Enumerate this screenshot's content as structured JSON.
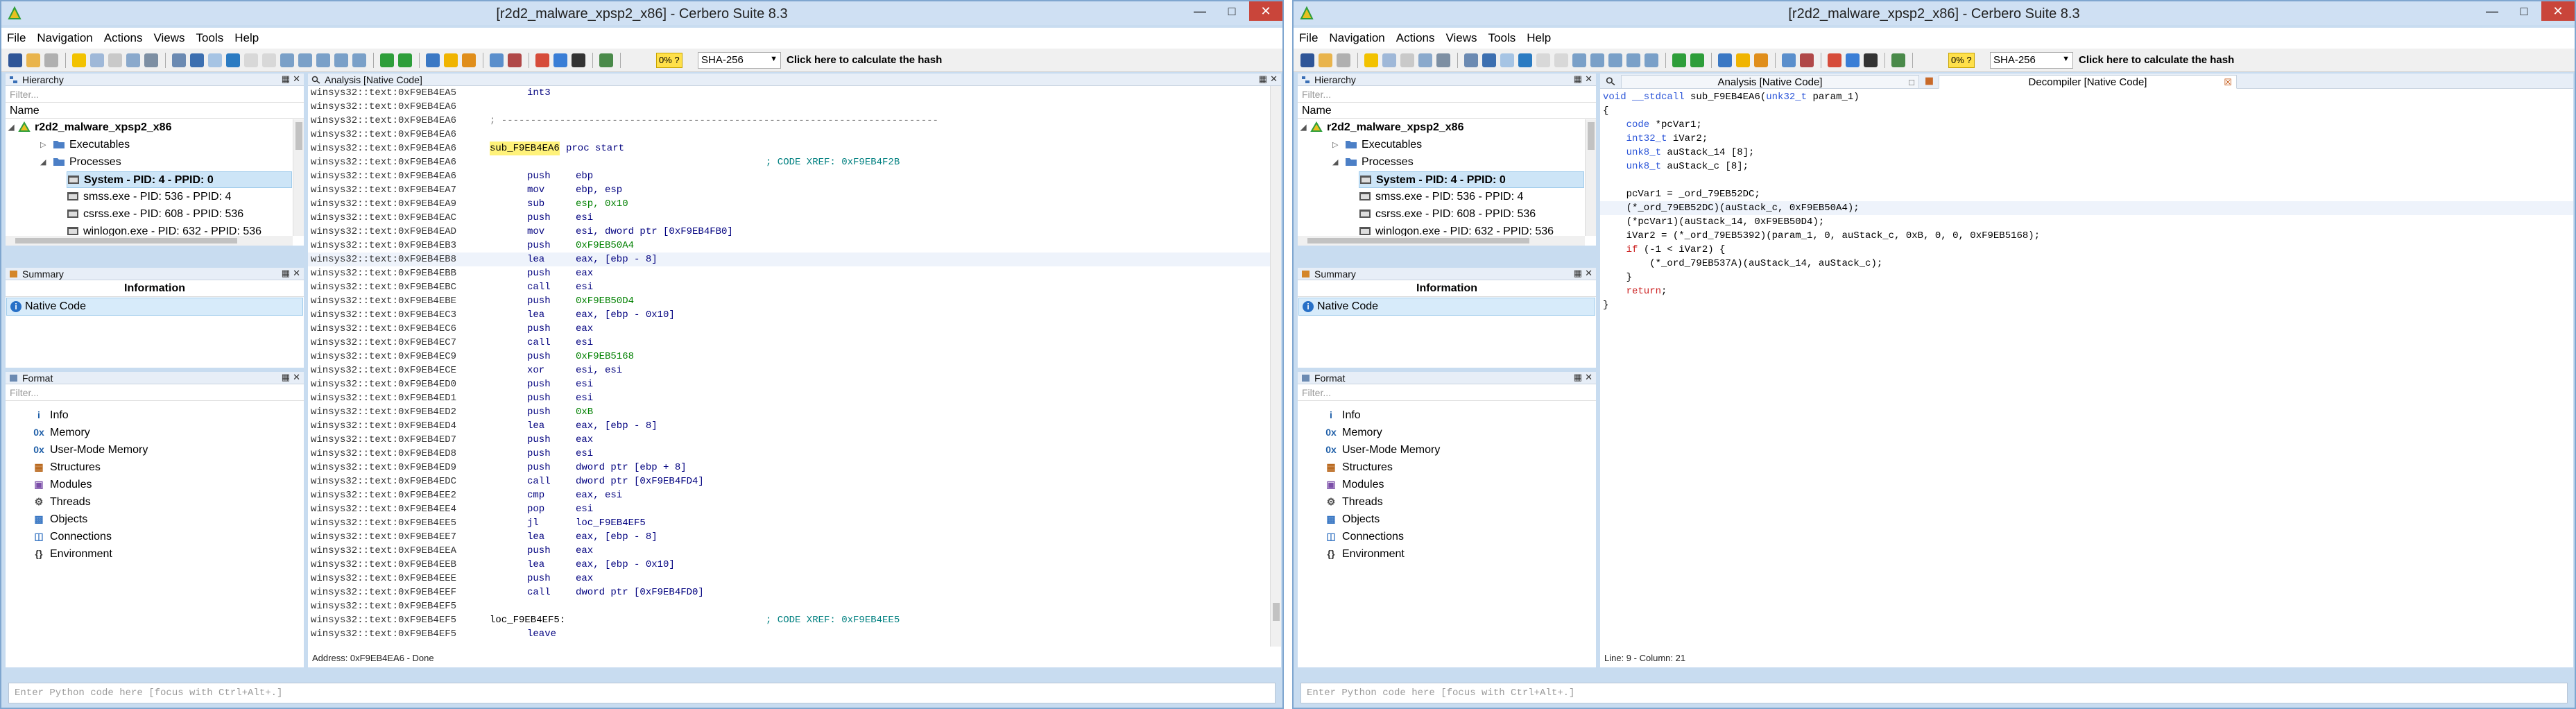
{
  "left": {
    "title": "[r2d2_malware_xpsp2_x86] - Cerbero Suite 8.3",
    "menu": [
      "File",
      "Navigation",
      "Actions",
      "Views",
      "Tools",
      "Help"
    ],
    "toolbar": {
      "badge": "0% ?",
      "hash_algo": "SHA-256",
      "calc_hash": "Click here to calculate the hash"
    },
    "hierarchy": {
      "header": "Hierarchy",
      "filter_placeholder": "Filter...",
      "column": "Name",
      "items": [
        "r2d2_malware_xpsp2_x86",
        "Executables",
        "Processes",
        "System - PID: 4 - PPID: 0",
        "smss.exe - PID: 536 - PPID: 4",
        "csrss.exe - PID: 608 - PPID: 536",
        "winlogon.exe - PID: 632 - PPID: 536"
      ]
    },
    "summary": {
      "header": "Summary",
      "title": "Information",
      "row": "Native Code"
    },
    "format": {
      "header": "Format",
      "filter_placeholder": "Filter...",
      "items": [
        "Info",
        "Memory",
        "User-Mode Memory",
        "Structures",
        "Modules",
        "Threads",
        "Objects",
        "Connections",
        "Environment"
      ],
      "icons": [
        "info-icon",
        "memory-icon",
        "memory-icon",
        "structures-icon",
        "modules-icon",
        "threads-icon",
        "objects-icon",
        "connections-icon",
        "environment-icon"
      ]
    },
    "analysis": {
      "header": "Analysis [Native Code]",
      "status": "Address: 0xF9EB4EA6 - Done",
      "lines": [
        {
          "a": "winsys32::text:0xF9EB4EA5",
          "m": "int3",
          "o": "",
          "c": ""
        },
        {
          "a": "winsys32::text:0xF9EB4EA6",
          "m": "",
          "o": "",
          "c": ""
        },
        {
          "a": "winsys32::text:0xF9EB4EA6",
          "m": "; ---------------------------------------------------------------------------",
          "o": "",
          "c": ""
        },
        {
          "a": "winsys32::text:0xF9EB4EA6",
          "m": "",
          "o": "",
          "c": ""
        },
        {
          "a": "winsys32::text:0xF9EB4EA6",
          "m": "sub_F9EB4EA6",
          "o": "proc start",
          "c": ""
        },
        {
          "a": "winsys32::text:0xF9EB4EA6",
          "m": "",
          "o": "",
          "c": "; CODE XREF: 0xF9EB4F2B"
        },
        {
          "a": "winsys32::text:0xF9EB4EA6",
          "m": "push",
          "o": "ebp",
          "c": ""
        },
        {
          "a": "winsys32::text:0xF9EB4EA7",
          "m": "mov",
          "o": "ebp, esp",
          "c": ""
        },
        {
          "a": "winsys32::text:0xF9EB4EA9",
          "m": "sub",
          "o": "esp, 0x10",
          "c": ""
        },
        {
          "a": "winsys32::text:0xF9EB4EAC",
          "m": "push",
          "o": "esi",
          "c": ""
        },
        {
          "a": "winsys32::text:0xF9EB4EAD",
          "m": "mov",
          "o": "esi, dword ptr [0xF9EB4FB0]",
          "c": ""
        },
        {
          "a": "winsys32::text:0xF9EB4EB3",
          "m": "push",
          "o": "0xF9EB50A4",
          "c": ""
        },
        {
          "a": "winsys32::text:0xF9EB4EB8",
          "m": "lea",
          "o": "eax, [ebp - 8]",
          "c": ""
        },
        {
          "a": "winsys32::text:0xF9EB4EBB",
          "m": "push",
          "o": "eax",
          "c": ""
        },
        {
          "a": "winsys32::text:0xF9EB4EBC",
          "m": "call",
          "o": "esi",
          "c": ""
        },
        {
          "a": "winsys32::text:0xF9EB4EBE",
          "m": "push",
          "o": "0xF9EB50D4",
          "c": ""
        },
        {
          "a": "winsys32::text:0xF9EB4EC3",
          "m": "lea",
          "o": "eax, [ebp - 0x10]",
          "c": ""
        },
        {
          "a": "winsys32::text:0xF9EB4EC6",
          "m": "push",
          "o": "eax",
          "c": ""
        },
        {
          "a": "winsys32::text:0xF9EB4EC7",
          "m": "call",
          "o": "esi",
          "c": ""
        },
        {
          "a": "winsys32::text:0xF9EB4EC9",
          "m": "push",
          "o": "0xF9EB5168",
          "c": ""
        },
        {
          "a": "winsys32::text:0xF9EB4ECE",
          "m": "xor",
          "o": "esi, esi",
          "c": ""
        },
        {
          "a": "winsys32::text:0xF9EB4ED0",
          "m": "push",
          "o": "esi",
          "c": ""
        },
        {
          "a": "winsys32::text:0xF9EB4ED1",
          "m": "push",
          "o": "esi",
          "c": ""
        },
        {
          "a": "winsys32::text:0xF9EB4ED2",
          "m": "push",
          "o": "0xB",
          "c": ""
        },
        {
          "a": "winsys32::text:0xF9EB4ED4",
          "m": "lea",
          "o": "eax, [ebp - 8]",
          "c": ""
        },
        {
          "a": "winsys32::text:0xF9EB4ED7",
          "m": "push",
          "o": "eax",
          "c": ""
        },
        {
          "a": "winsys32::text:0xF9EB4ED8",
          "m": "push",
          "o": "esi",
          "c": ""
        },
        {
          "a": "winsys32::text:0xF9EB4ED9",
          "m": "push",
          "o": "dword ptr [ebp + 8]",
          "c": ""
        },
        {
          "a": "winsys32::text:0xF9EB4EDC",
          "m": "call",
          "o": "dword ptr [0xF9EB4FD4]",
          "c": ""
        },
        {
          "a": "winsys32::text:0xF9EB4EE2",
          "m": "cmp",
          "o": "eax, esi",
          "c": ""
        },
        {
          "a": "winsys32::text:0xF9EB4EE4",
          "m": "pop",
          "o": "esi",
          "c": ""
        },
        {
          "a": "winsys32::text:0xF9EB4EE5",
          "m": "jl",
          "o": "loc_F9EB4EF5",
          "c": ""
        },
        {
          "a": "winsys32::text:0xF9EB4EE7",
          "m": "lea",
          "o": "eax, [ebp - 8]",
          "c": ""
        },
        {
          "a": "winsys32::text:0xF9EB4EEA",
          "m": "push",
          "o": "eax",
          "c": ""
        },
        {
          "a": "winsys32::text:0xF9EB4EEB",
          "m": "lea",
          "o": "eax, [ebp - 0x10]",
          "c": ""
        },
        {
          "a": "winsys32::text:0xF9EB4EEE",
          "m": "push",
          "o": "eax",
          "c": ""
        },
        {
          "a": "winsys32::text:0xF9EB4EEF",
          "m": "call",
          "o": "dword ptr [0xF9EB4FD0]",
          "c": ""
        },
        {
          "a": "winsys32::text:0xF9EB4EF5",
          "m": "",
          "o": "",
          "c": ""
        },
        {
          "a": "winsys32::text:0xF9EB4EF5",
          "m": "loc_F9EB4EF5:",
          "o": "",
          "c": "; CODE XREF: 0xF9EB4EE5"
        },
        {
          "a": "winsys32::text:0xF9EB4EF5",
          "m": "leave",
          "o": "",
          "c": ""
        }
      ]
    },
    "python_placeholder": "Enter Python code here [focus with Ctrl+Alt+.]"
  },
  "right": {
    "title": "[r2d2_malware_xpsp2_x86] - Cerbero Suite 8.3",
    "menu": [
      "File",
      "Navigation",
      "Actions",
      "Views",
      "Tools",
      "Help"
    ],
    "toolbar": {
      "badge": "0% ?",
      "hash_algo": "SHA-256",
      "calc_hash": "Click here to calculate the hash"
    },
    "hierarchy": {
      "header": "Hierarchy",
      "filter_placeholder": "Filter...",
      "column": "Name",
      "items": [
        "r2d2_malware_xpsp2_x86",
        "Executables",
        "Processes",
        "System - PID: 4 - PPID: 0",
        "smss.exe - PID: 536 - PPID: 4",
        "csrss.exe - PID: 608 - PPID: 536",
        "winlogon.exe - PID: 632 - PPID: 536"
      ]
    },
    "summary": {
      "header": "Summary",
      "title": "Information",
      "row": "Native Code"
    },
    "format": {
      "header": "Format",
      "filter_placeholder": "Filter...",
      "items": [
        "Info",
        "Memory",
        "User-Mode Memory",
        "Structures",
        "Modules",
        "Threads",
        "Objects",
        "Connections",
        "Environment"
      ]
    },
    "tabs": [
      "Analysis [Native Code]",
      "Decompiler [Native Code]"
    ],
    "decompiler": {
      "status": "Line: 9 - Column: 21",
      "lines": [
        [
          {
            "t": "void __stdcall ",
            "k": "ty"
          },
          {
            "t": "sub_F9EB4EA6(",
            "k": "lbl"
          },
          {
            "t": "unk32_t",
            "k": "ty"
          },
          {
            "t": " param_1)",
            "k": "lbl"
          }
        ],
        [
          {
            "t": "{",
            "k": "lbl"
          }
        ],
        [
          {
            "t": "    code",
            "k": "ty"
          },
          {
            "t": " *pcVar1;",
            "k": "lbl"
          }
        ],
        [
          {
            "t": "    int32_t",
            "k": "ty"
          },
          {
            "t": " iVar2;",
            "k": "lbl"
          }
        ],
        [
          {
            "t": "    unk8_t",
            "k": "ty"
          },
          {
            "t": " auStack_14 [8];",
            "k": "lbl"
          }
        ],
        [
          {
            "t": "    unk8_t",
            "k": "ty"
          },
          {
            "t": " auStack_c [8];",
            "k": "lbl"
          }
        ],
        [
          {
            "t": "",
            "k": "lbl"
          }
        ],
        [
          {
            "t": "    pcVar1 = _ord_79EB52DC;",
            "k": "lbl"
          }
        ],
        [
          {
            "t": "    (*_ord_79EB52DC)(auStack_c, 0xF9EB50A4);",
            "k": "lbl"
          }
        ],
        [
          {
            "t": "    (*pcVar1)(auStack_14, 0xF9EB50D4);",
            "k": "lbl"
          }
        ],
        [
          {
            "t": "    iVar2 = (*_ord_79EB5392)(param_1, 0, auStack_c, 0xB, 0, 0, 0xF9EB5168);",
            "k": "lbl"
          }
        ],
        [
          {
            "t": "    if",
            "k": "kw"
          },
          {
            "t": " (-1 < iVar2) {",
            "k": "lbl"
          }
        ],
        [
          {
            "t": "        (*_ord_79EB537A)(auStack_14, auStack_c);",
            "k": "lbl"
          }
        ],
        [
          {
            "t": "    }",
            "k": "lbl"
          }
        ],
        [
          {
            "t": "    return",
            "k": "kw"
          },
          {
            "t": ";",
            "k": "lbl"
          }
        ],
        [
          {
            "t": "}",
            "k": "lbl"
          }
        ]
      ]
    },
    "python_placeholder": "Enter Python code here [focus with Ctrl+Alt+.]"
  },
  "colors": {
    "frame": "#c8dcf0",
    "close": "#c9453a",
    "selection": "#cde5f7",
    "mnemonic": "#00007f",
    "comment": "#008080",
    "number": "#008000"
  }
}
